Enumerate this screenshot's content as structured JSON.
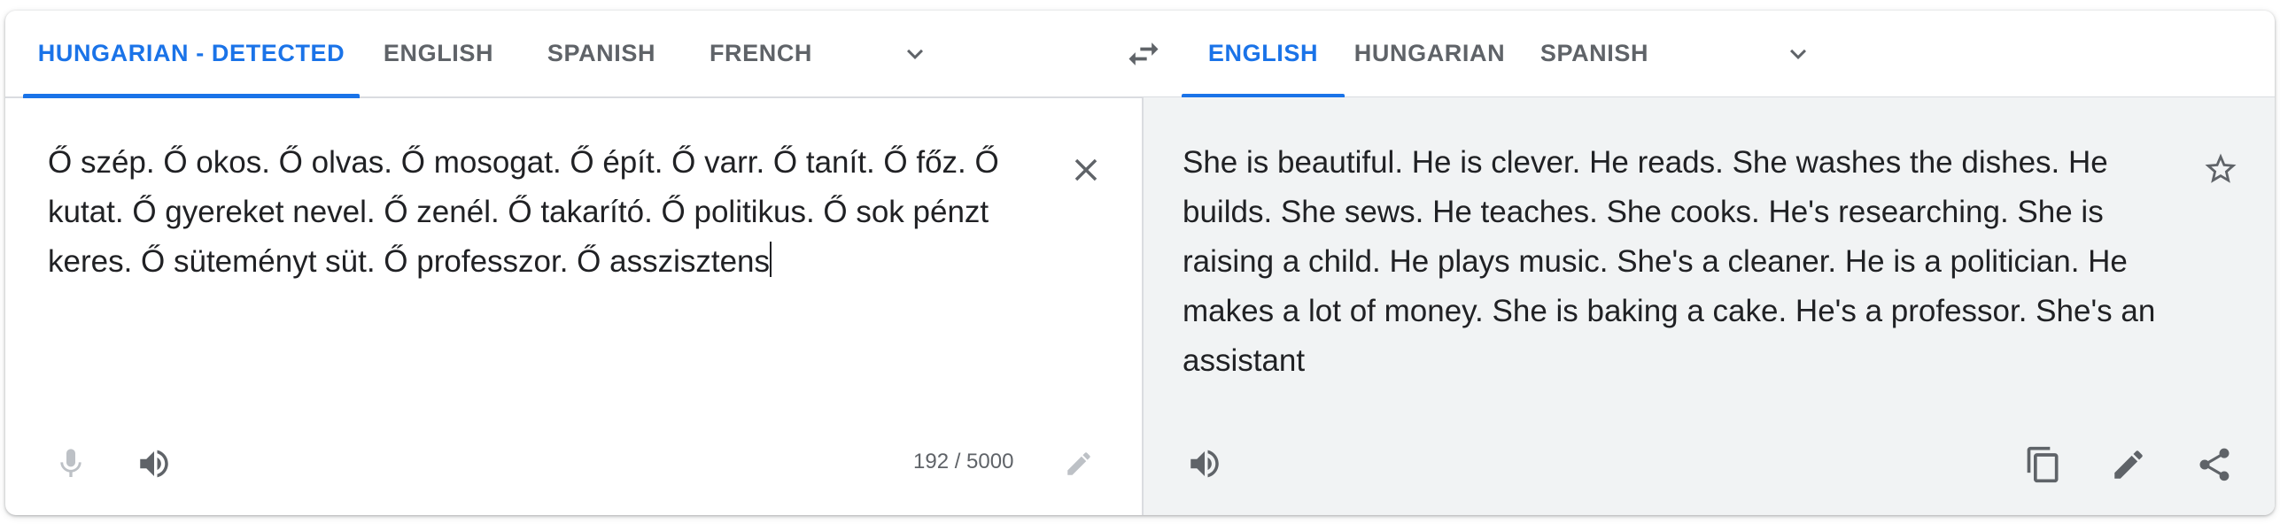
{
  "source_tabs": [
    "HUNGARIAN - DETECTED",
    "ENGLISH",
    "SPANISH",
    "FRENCH"
  ],
  "target_tabs": [
    "ENGLISH",
    "HUNGARIAN",
    "SPANISH"
  ],
  "source_text": "Ő szép. Ő okos. Ő olvas. Ő mosogat. Ő épít. Ő varr. Ő tanít. Ő főz. Ő kutat. Ő gyereket nevel. Ő zenél. Ő takarító. Ő politikus. Ő sok pénzt keres. Ő süteményt süt. Ő professzor. Ő asszisztens",
  "translation_text": "She is beautiful. He is clever. He reads. She washes the dishes. He builds. She sews. He teaches. She cooks. He's researching. She is raising a child. He plays music. She's a cleaner. He is a politician. He makes a lot of money. She is baking a cake. He's a professor. She's an assistant",
  "char_count": "192 / 5000",
  "icons": {
    "more_source_languages": "chevron-down-icon",
    "swap_languages": "swap-icon",
    "more_target_languages": "chevron-down-icon",
    "clear": "close-icon",
    "save": "star-icon",
    "voice_input": "microphone-icon",
    "listen_source": "speaker-icon",
    "edit_source": "pencil-icon",
    "listen_translation": "speaker-icon",
    "copy": "copy-icon",
    "edit_translation": "pencil-icon",
    "share": "share-icon"
  },
  "colors": {
    "accent": "#1a73e8",
    "text": "#202124",
    "muted": "#5f6368",
    "disabled": "#bdc1c6",
    "translation_bg": "#f1f3f4"
  }
}
